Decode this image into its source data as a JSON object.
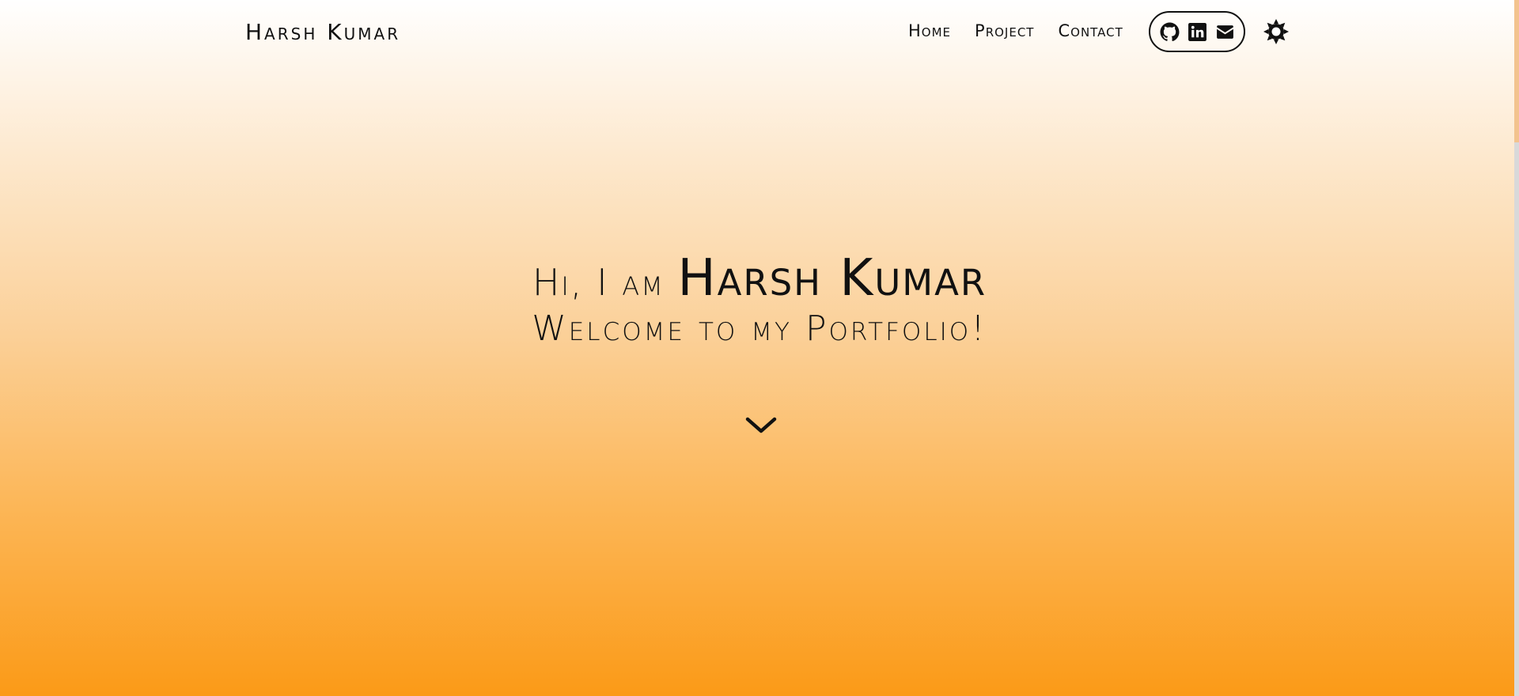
{
  "navbar": {
    "brand": "Harsh Kumar",
    "links": [
      {
        "label": "Home"
      },
      {
        "label": "Project"
      },
      {
        "label": "Contact"
      }
    ],
    "social_icons": [
      "github-icon",
      "linkedin-icon",
      "envelope-icon"
    ],
    "theme_icon": "sun-icon"
  },
  "hero": {
    "greeting": "Hi, I am ",
    "name": "Harsh Kumar",
    "welcome": "Welcome to my Portfolio!",
    "scroll_icon": "chevron-down-icon"
  },
  "colors": {
    "gradient_top": "#ffffff",
    "gradient_bottom": "#fb9a17",
    "text": "#111111"
  }
}
